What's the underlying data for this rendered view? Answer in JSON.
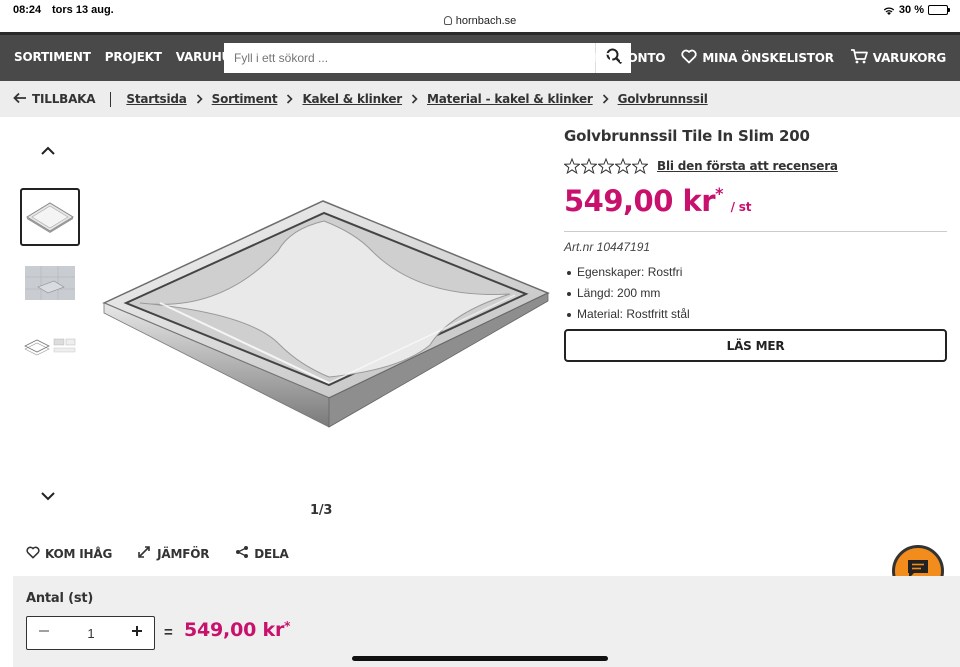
{
  "status_bar": {
    "time": "08:24",
    "date": "tors 13 aug.",
    "url": "hornbach.se",
    "battery": "30 %"
  },
  "nav": {
    "menu": [
      "SORTIMENT",
      "PROJEKT",
      "VARUHUSINFO"
    ],
    "search_placeholder": "Fyll i ett sökord ...",
    "account": "MITT KONTO",
    "wishlists": "MINA ÖNSKELISTOR",
    "cart": "VARUKORG"
  },
  "breadcrumb": {
    "back": "TILLBAKA",
    "items": [
      "Startsida",
      "Sortiment",
      "Kakel & klinker",
      "Material - kakel & klinker",
      "Golvbrunnssil"
    ]
  },
  "gallery": {
    "counter": "1/3"
  },
  "product": {
    "title": "Golvbrunnssil Tile In Slim 200",
    "rating": 0,
    "review_link": "Bli den första att recensera",
    "price": "549,00 kr",
    "price_mark": "*",
    "price_unit": "/ st",
    "art_nr": "Art.nr 10447191",
    "properties": [
      "Egenskaper: Rostfri",
      "Längd: 200 mm",
      "Material: Rostfritt stål"
    ],
    "read_more": "LÄS MER"
  },
  "actions": {
    "remember": "KOM IHÅG",
    "compare": "JÄMFÖR",
    "share": "DELA"
  },
  "quantity": {
    "label": "Antal (st)",
    "value": "1",
    "equals": "=",
    "total": "549,00 kr",
    "total_mark": "*"
  },
  "colors": {
    "accent": "#c8116d",
    "nav_bg": "#494949",
    "chat": "#f28c1c"
  }
}
